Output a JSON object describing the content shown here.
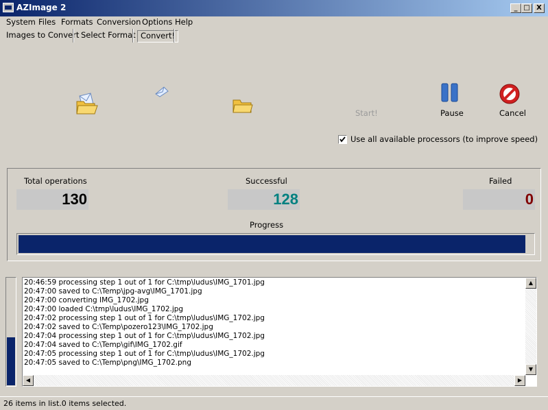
{
  "window": {
    "title": "AZImage 2",
    "minimize": "_",
    "maximize": "□",
    "close": "X"
  },
  "menu": [
    "System",
    "Files",
    "Formats",
    "Conversion",
    "Options",
    "Help"
  ],
  "tabs": [
    "Images to Convert",
    "Select Format",
    "Convert!"
  ],
  "toolbar": {
    "start": "Start!",
    "pause": "Pause",
    "cancel": "Cancel"
  },
  "options": {
    "use_all_processors": "Use all available processors (to improve speed)",
    "use_all_processors_checked": true
  },
  "stats": {
    "total_label": "Total operations",
    "total_value": "130",
    "success_label": "Successful",
    "success_value": "128",
    "failed_label": "Failed",
    "failed_value": "0",
    "progress_label": "Progress",
    "progress_fraction": 0.985
  },
  "colors": {
    "accent": "#0a246a",
    "success": "#008080",
    "failed": "#800000"
  },
  "activity_fraction": 0.45,
  "log": [
    "20:46:59 processing step 1 out of 1 for C:\\tmp\\ludus\\IMG_1701.jpg",
    "20:47:00 saved to C:\\Temp\\jpg-avg\\IMG_1701.jpg",
    "20:47:00 converting IMG_1702.jpg",
    "20:47:00 loaded C:\\tmp\\ludus\\IMG_1702.jpg",
    "20:47:02 processing step 1 out of 1 for C:\\tmp\\ludus\\IMG_1702.jpg",
    "20:47:02 saved to C:\\Temp\\pozero123\\IMG_1702.jpg",
    "20:47:04 processing step 1 out of 1 for C:\\tmp\\ludus\\IMG_1702.jpg",
    "20:47:04 saved to C:\\Temp\\gif\\IMG_1702.gif",
    "20:47:05 processing step 1 out of 1 for C:\\tmp\\ludus\\IMG_1702.jpg",
    "20:47:05 saved to C:\\Temp\\png\\IMG_1702.png"
  ],
  "status": "26 items in list.0 items selected."
}
